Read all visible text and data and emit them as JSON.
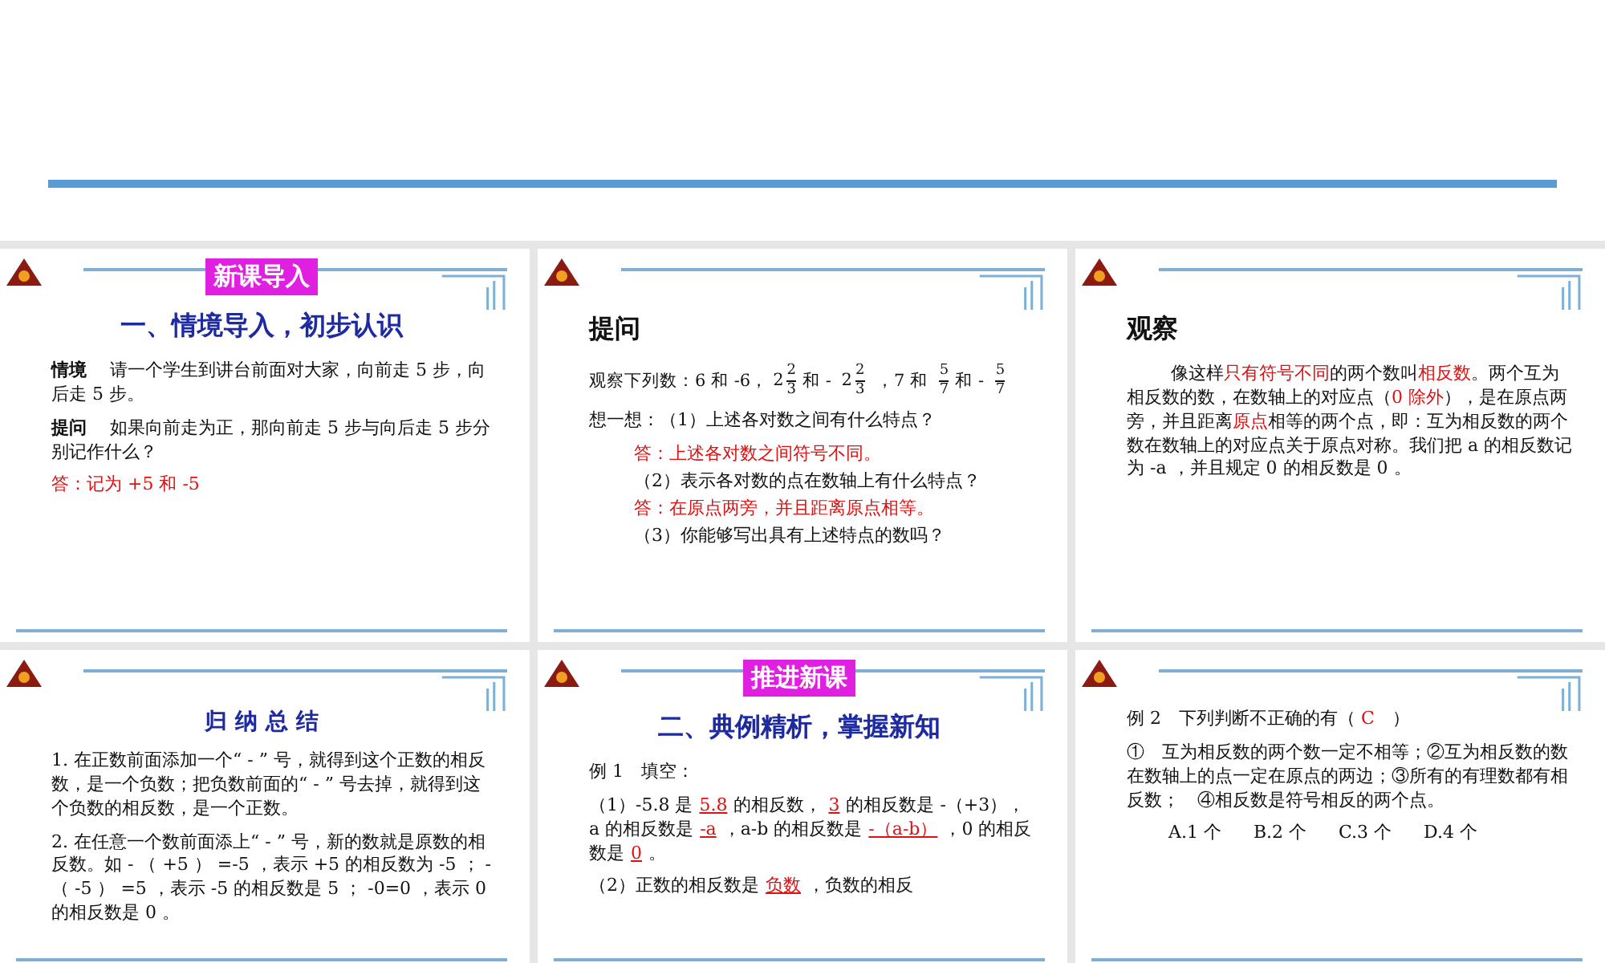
{
  "slides": [
    {
      "badge": "新课导入",
      "title": {
        "text": "一、情境导入，初步认识",
        "kind": "blue"
      },
      "paragraphs": [
        {
          "inset": false,
          "indent": false,
          "segments": [
            {
              "kind": "bold",
              "text": "情境"
            },
            {
              "kind": "plain",
              "text": "　 请一个学生到讲台前面对大家，向前走 5 步，向后走 5 步。"
            }
          ]
        },
        {
          "inset": false,
          "indent": false,
          "segments": [
            {
              "kind": "bold",
              "text": "提问"
            },
            {
              "kind": "plain",
              "text": "　 如果向前走为正，那向前走 5 步与向后走 5 步分别记作什么？"
            }
          ]
        },
        {
          "inset": false,
          "indent": false,
          "segments": [
            {
              "kind": "red",
              "text": "答：记为 +5 和 -5"
            }
          ]
        }
      ]
    },
    {
      "title": {
        "text": "提问",
        "kind": "black"
      },
      "paragraphs": [
        {
          "inset": false,
          "indent": false,
          "segments": [
            {
              "kind": "plain",
              "text": "观察下列数：6 和 -6，"
            },
            {
              "kind": "fraction",
              "whole": "2",
              "num": "2",
              "den": "3"
            },
            {
              "kind": "plain",
              "text": "和 - "
            },
            {
              "kind": "fraction",
              "whole": "2",
              "num": "2",
              "den": "3"
            },
            {
              "kind": "plain",
              "text": " ，7 和 "
            },
            {
              "kind": "fraction",
              "num": "5",
              "den": "7"
            },
            {
              "kind": "plain",
              "text": "和 - "
            },
            {
              "kind": "fraction",
              "num": "5",
              "den": "7"
            }
          ]
        },
        {
          "inset": false,
          "indent": false,
          "segments": [
            {
              "kind": "plain",
              "text": "想一想：（1）上述各对数之间有什么特点？"
            }
          ]
        },
        {
          "inset": true,
          "indent": false,
          "segments": [
            {
              "kind": "red",
              "text": "答：上述各对数之间符号不同。"
            }
          ]
        },
        {
          "inset": true,
          "indent": false,
          "segments": [
            {
              "kind": "plain",
              "text": "（2）表示各对数的点在数轴上有什么特点？"
            }
          ]
        },
        {
          "inset": true,
          "indent": false,
          "segments": [
            {
              "kind": "red",
              "text": "答：在原点两旁，并且距离原点相等。"
            }
          ]
        },
        {
          "inset": true,
          "indent": false,
          "segments": [
            {
              "kind": "plain",
              "text": "（3）你能够写出具有上述特点的数吗？"
            }
          ]
        }
      ]
    },
    {
      "title": {
        "text": "观察",
        "kind": "black"
      },
      "paragraphs": [
        {
          "inset": false,
          "indent": true,
          "segments": [
            {
              "kind": "plain",
              "text": "像这样"
            },
            {
              "kind": "red",
              "text": "只有符号不同"
            },
            {
              "kind": "plain",
              "text": "的两个数叫"
            },
            {
              "kind": "red",
              "text": "相反数"
            },
            {
              "kind": "plain",
              "text": "。两个互为相反数的数，在数轴上的对应点（"
            },
            {
              "kind": "red",
              "text": "0 除外"
            },
            {
              "kind": "plain",
              "text": "），是在原点两旁，并且距离"
            },
            {
              "kind": "red",
              "text": "原点"
            },
            {
              "kind": "plain",
              "text": "相等的两个点，即：互为相反数的两个数在数轴上的对应点关于原点对称。我们把 a 的相反数记为 -a ，并且规定 0 的相反数是 0 。"
            }
          ]
        }
      ]
    },
    {
      "title": {
        "text": "归 纳 总 结",
        "kind": "spaced"
      },
      "paragraphs": [
        {
          "inset": false,
          "indent": false,
          "segments": [
            {
              "kind": "plain",
              "text": "1. 在正数前面添加一个“ - ” 号，就得到这个正数的相反数，是一个负数；把负数前面的“ - ” 号去掉，就得到这个负数的相反数，是一个正数。"
            }
          ]
        },
        {
          "inset": false,
          "indent": false,
          "segments": [
            {
              "kind": "plain",
              "text": "2. 在任意一个数前面添上“ - ” 号，新的数就是原数的相反数。如 - （ +5 ） =-5 ，表示 +5 的相反数为 -5 ； - （ -5 ） =5 ，表示 -5 的相反数是 5 ； -0=0 ，表示 0 的相反数是 0 。"
            }
          ]
        }
      ]
    },
    {
      "badge": "推进新课",
      "title": {
        "text": "二、典例精析，掌握新知",
        "kind": "blue"
      },
      "paragraphs": [
        {
          "inset": false,
          "indent": false,
          "segments": [
            {
              "kind": "plain",
              "text": "例 1　填空："
            }
          ]
        },
        {
          "inset": false,
          "indent": false,
          "segments": [
            {
              "kind": "plain",
              "text": "（1）-5.8 是"
            },
            {
              "kind": "blank",
              "text": "5.8"
            },
            {
              "kind": "plain",
              "text": "的相反数，"
            },
            {
              "kind": "blank",
              "text": "3"
            },
            {
              "kind": "plain",
              "text": "的相反数是 -（+3），a 的相反数是"
            },
            {
              "kind": "blank",
              "text": "-a"
            },
            {
              "kind": "plain",
              "text": "，a-b 的相反数是"
            },
            {
              "kind": "blank",
              "text": "-（a-b）"
            },
            {
              "kind": "plain",
              "text": "，0 的相反数是"
            },
            {
              "kind": "blank",
              "text": "0"
            },
            {
              "kind": "plain",
              "text": "。"
            }
          ]
        },
        {
          "inset": false,
          "indent": false,
          "segments": [
            {
              "kind": "plain",
              "text": "（2）正数的相反数是"
            },
            {
              "kind": "blank",
              "text": "负数"
            },
            {
              "kind": "plain",
              "text": "，负数的相反"
            }
          ]
        }
      ]
    },
    {
      "paragraphs": [
        {
          "inset": false,
          "indent": false,
          "segments": [
            {
              "kind": "plain",
              "text": "例 2　下列判断不正确的有（ "
            },
            {
              "kind": "red",
              "text": "C"
            },
            {
              "kind": "plain",
              "text": "　）"
            }
          ]
        },
        {
          "inset": false,
          "indent": false,
          "segments": [
            {
              "kind": "plain",
              "text": "①　互为相反数的两个数一定不相等；②互为相反数的数在数轴上的点一定在原点的两边；③所有的有理数都有相反数；　④相反数是符号相反的两个点。"
            }
          ]
        }
      ],
      "options": [
        "A.1 个",
        "B.2 个",
        "C.3 个",
        "D.4 个"
      ]
    }
  ]
}
